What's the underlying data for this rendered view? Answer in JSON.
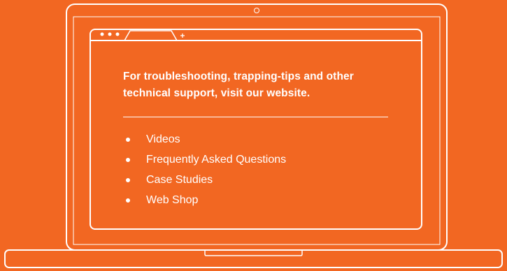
{
  "colors": {
    "background": "#f26722",
    "foreground": "#ffffff"
  },
  "illustration": {
    "device": "laptop",
    "webcam_icon": "camera-dot",
    "browser_controls": "window-dots",
    "new_tab_icon": "plus-icon"
  },
  "content": {
    "headline_line1": "For troubleshooting, trapping-tips and other",
    "headline_line2": "technical support, visit our website.",
    "links": [
      {
        "label": "Videos"
      },
      {
        "label": "Frequently Asked Questions"
      },
      {
        "label": "Case Studies"
      },
      {
        "label": "Web Shop"
      }
    ]
  }
}
